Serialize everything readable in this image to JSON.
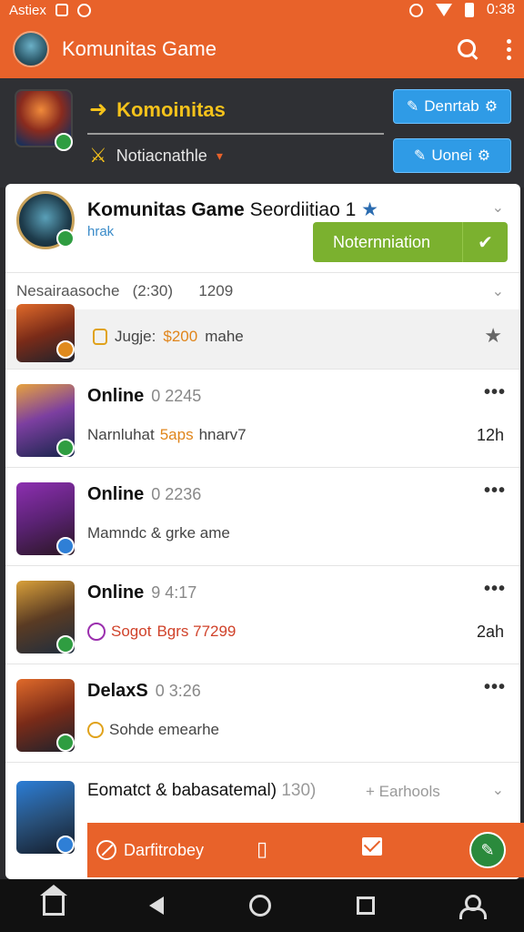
{
  "status_bar": {
    "carrier": "Astiex",
    "clock": "0:38"
  },
  "app_bar": {
    "title": "Komunitas Game"
  },
  "header": {
    "back_label": "Komoinitas",
    "sub_label": "Notiacnathle",
    "button1_label": "Denrtab",
    "button2_label": "Uonei"
  },
  "group": {
    "title_bold": "Komunitas Game",
    "title_rest": "Seordiitiao 1",
    "sub": "hrak",
    "notification_label": "Noternniation"
  },
  "section": {
    "label": "Nesairaasoche",
    "count": "(2:30)",
    "extra": "1209"
  },
  "pinned": {
    "prefix": "Jugje:",
    "amount": "$200",
    "suffix": "mahe"
  },
  "posts": [
    {
      "title": "Online",
      "time": "0 2245",
      "body_a": "Narnluhat",
      "body_b": "5aps",
      "body_c": "hnarv7",
      "count": "12h",
      "thumb_icon": "warrior-portrait"
    },
    {
      "title": "Online",
      "time": "0 2236",
      "body_a": "Mamndc & grke ame",
      "body_b": "",
      "body_c": "",
      "count": "",
      "thumb_icon": "mage-portrait"
    },
    {
      "title": "Online",
      "time": "9 4:17",
      "body_a": "Sogot",
      "body_b": "Bgrs 77299",
      "body_c": "",
      "count": "2ah",
      "thumb_icon": "knight-portrait"
    },
    {
      "title": "DelaxS",
      "time": "0 3:26",
      "body_a": "Sohde emearhe",
      "body_b": "",
      "body_c": "",
      "count": "",
      "thumb_icon": "barbarian-portrait"
    }
  ],
  "last_row": {
    "title": "Eomatct & babasatemal)",
    "num": "130)",
    "extra": "+ Earhools"
  },
  "action_bar": {
    "label": "Darfitrobey"
  },
  "colors": {
    "accent": "#e8622a",
    "green": "#7bb12f",
    "blue": "#2f9be6"
  }
}
